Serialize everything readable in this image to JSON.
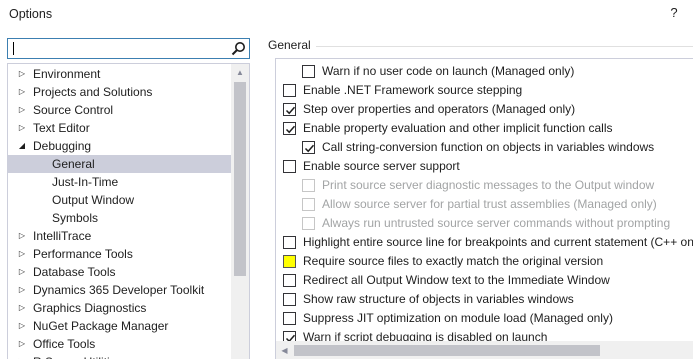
{
  "window": {
    "title": "Options",
    "help_label": "?"
  },
  "search": {
    "value": "",
    "placeholder": ""
  },
  "tree": {
    "items": [
      {
        "label": "Environment",
        "state": "collapsed"
      },
      {
        "label": "Projects and Solutions",
        "state": "collapsed"
      },
      {
        "label": "Source Control",
        "state": "collapsed"
      },
      {
        "label": "Text Editor",
        "state": "collapsed"
      },
      {
        "label": "Debugging",
        "state": "expanded"
      },
      {
        "label": "General",
        "state": "child",
        "selected": true
      },
      {
        "label": "Just-In-Time",
        "state": "child"
      },
      {
        "label": "Output Window",
        "state": "child"
      },
      {
        "label": "Symbols",
        "state": "child"
      },
      {
        "label": "IntelliTrace",
        "state": "collapsed"
      },
      {
        "label": "Performance Tools",
        "state": "collapsed"
      },
      {
        "label": "Database Tools",
        "state": "collapsed"
      },
      {
        "label": "Dynamics 365 Developer Toolkit",
        "state": "collapsed"
      },
      {
        "label": "Graphics Diagnostics",
        "state": "collapsed"
      },
      {
        "label": "NuGet Package Manager",
        "state": "collapsed"
      },
      {
        "label": "Office Tools",
        "state": "collapsed"
      },
      {
        "label": "R Server Utilities",
        "state": "collapsed"
      }
    ]
  },
  "section": {
    "title": "General"
  },
  "options": [
    {
      "label": "Warn if no user code on launch (Managed only)",
      "checked": false,
      "indent": 1,
      "disabled": false
    },
    {
      "label": "Enable .NET Framework source stepping",
      "checked": false,
      "indent": 0,
      "disabled": false
    },
    {
      "label": "Step over properties and operators (Managed only)",
      "checked": true,
      "indent": 0,
      "disabled": false
    },
    {
      "label": "Enable property evaluation and other implicit function calls",
      "checked": true,
      "indent": 0,
      "disabled": false
    },
    {
      "label": "Call string-conversion function on objects in variables windows",
      "checked": true,
      "indent": 1,
      "disabled": false
    },
    {
      "label": "Enable source server support",
      "checked": false,
      "indent": 0,
      "disabled": false
    },
    {
      "label": "Print source server diagnostic messages to the Output window",
      "checked": false,
      "indent": 1,
      "disabled": true
    },
    {
      "label": "Allow source server for partial trust assemblies (Managed only)",
      "checked": false,
      "indent": 1,
      "disabled": true
    },
    {
      "label": "Always run untrusted source server commands without prompting",
      "checked": false,
      "indent": 1,
      "disabled": true
    },
    {
      "label": "Highlight entire source line for breakpoints and current statement (C++ only)",
      "checked": false,
      "indent": 0,
      "disabled": false
    },
    {
      "label": "Require source files to exactly match the original version",
      "checked": false,
      "indent": 0,
      "disabled": false,
      "highlight": true
    },
    {
      "label": "Redirect all Output Window text to the Immediate Window",
      "checked": false,
      "indent": 0,
      "disabled": false
    },
    {
      "label": "Show raw structure of objects in variables windows",
      "checked": false,
      "indent": 0,
      "disabled": false
    },
    {
      "label": "Suppress JIT optimization on module load (Managed only)",
      "checked": false,
      "indent": 0,
      "disabled": false
    },
    {
      "label": "Warn if script debugging is disabled on launch",
      "checked": true,
      "indent": 0,
      "disabled": false
    }
  ],
  "colors": {
    "highlight_checkbox": "#ffff00",
    "selected_tree_item": "#cccedb",
    "search_border": "#3c7fb1"
  }
}
